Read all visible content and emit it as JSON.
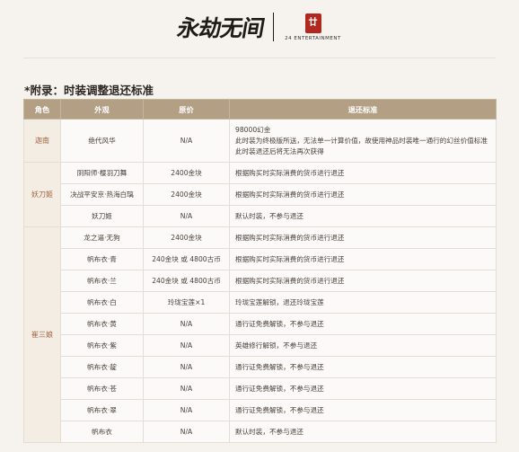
{
  "header": {
    "game_logo": "永劫无间",
    "seal_char": "廿",
    "company": "24 ENTERTAINMENT"
  },
  "section_title": "*附录：时装调整退还标准",
  "table": {
    "columns": [
      "角色",
      "外观",
      "原价",
      "退还标准"
    ],
    "groups": [
      {
        "role": "迦南",
        "rows": [
          {
            "item": "绝代风华",
            "price": "N/A",
            "standard": [
              "98000幻金",
              "此时装为终极版所送，无法单一计算价值，故使用神品时装唯一通行的幻丝价值标准",
              "此时装退还后将无法再次获得"
            ]
          }
        ]
      },
      {
        "role": "妖刀姬",
        "rows": [
          {
            "item": "阴阳师·樱羽刀舞",
            "price": "2400金块",
            "standard": [
              "根据购买时实际消费的货币进行退还"
            ]
          },
          {
            "item": "决战平安京·热海白璃",
            "price": "2400金块",
            "standard": [
              "根据购买时实际消费的货币进行退还"
            ]
          },
          {
            "item": "妖刀姬",
            "price": "N/A",
            "standard": [
              "默认时装，不参与退还"
            ]
          }
        ]
      },
      {
        "role": "崔三娘",
        "rows": [
          {
            "item": "龙之逼·无狗",
            "price": "2400金块",
            "standard": [
              "根据购买时实际消费的货币进行退还"
            ]
          },
          {
            "item": "帆布衣·青",
            "price": "240金块 或 4800古币",
            "standard": [
              "根据购买时实际消费的货币进行退还"
            ]
          },
          {
            "item": "帆布衣·兰",
            "price": "240金块 或 4800古币",
            "standard": [
              "根据购买时实际消费的货币进行退还"
            ]
          },
          {
            "item": "帆布衣·白",
            "price": "玲珑宝莲×1",
            "standard": [
              "玲珑宝莲解锁，退还玲珑宝莲"
            ]
          },
          {
            "item": "帆布衣·黄",
            "price": "N/A",
            "standard": [
              "通行证免费解锁，不参与退还"
            ]
          },
          {
            "item": "帆布衣·紫",
            "price": "N/A",
            "standard": [
              "英雄修行解锁，不参与退还"
            ]
          },
          {
            "item": "帆布衣·靛",
            "price": "N/A",
            "standard": [
              "通行证免费解锁，不参与退还"
            ]
          },
          {
            "item": "帆布衣·苍",
            "price": "N/A",
            "standard": [
              "通行证免费解锁，不参与退还"
            ]
          },
          {
            "item": "帆布衣·翠",
            "price": "N/A",
            "standard": [
              "通行证免费解锁，不参与退还"
            ]
          },
          {
            "item": "帆布衣",
            "price": "N/A",
            "standard": [
              "默认时装，不参与退还"
            ]
          }
        ]
      }
    ]
  }
}
